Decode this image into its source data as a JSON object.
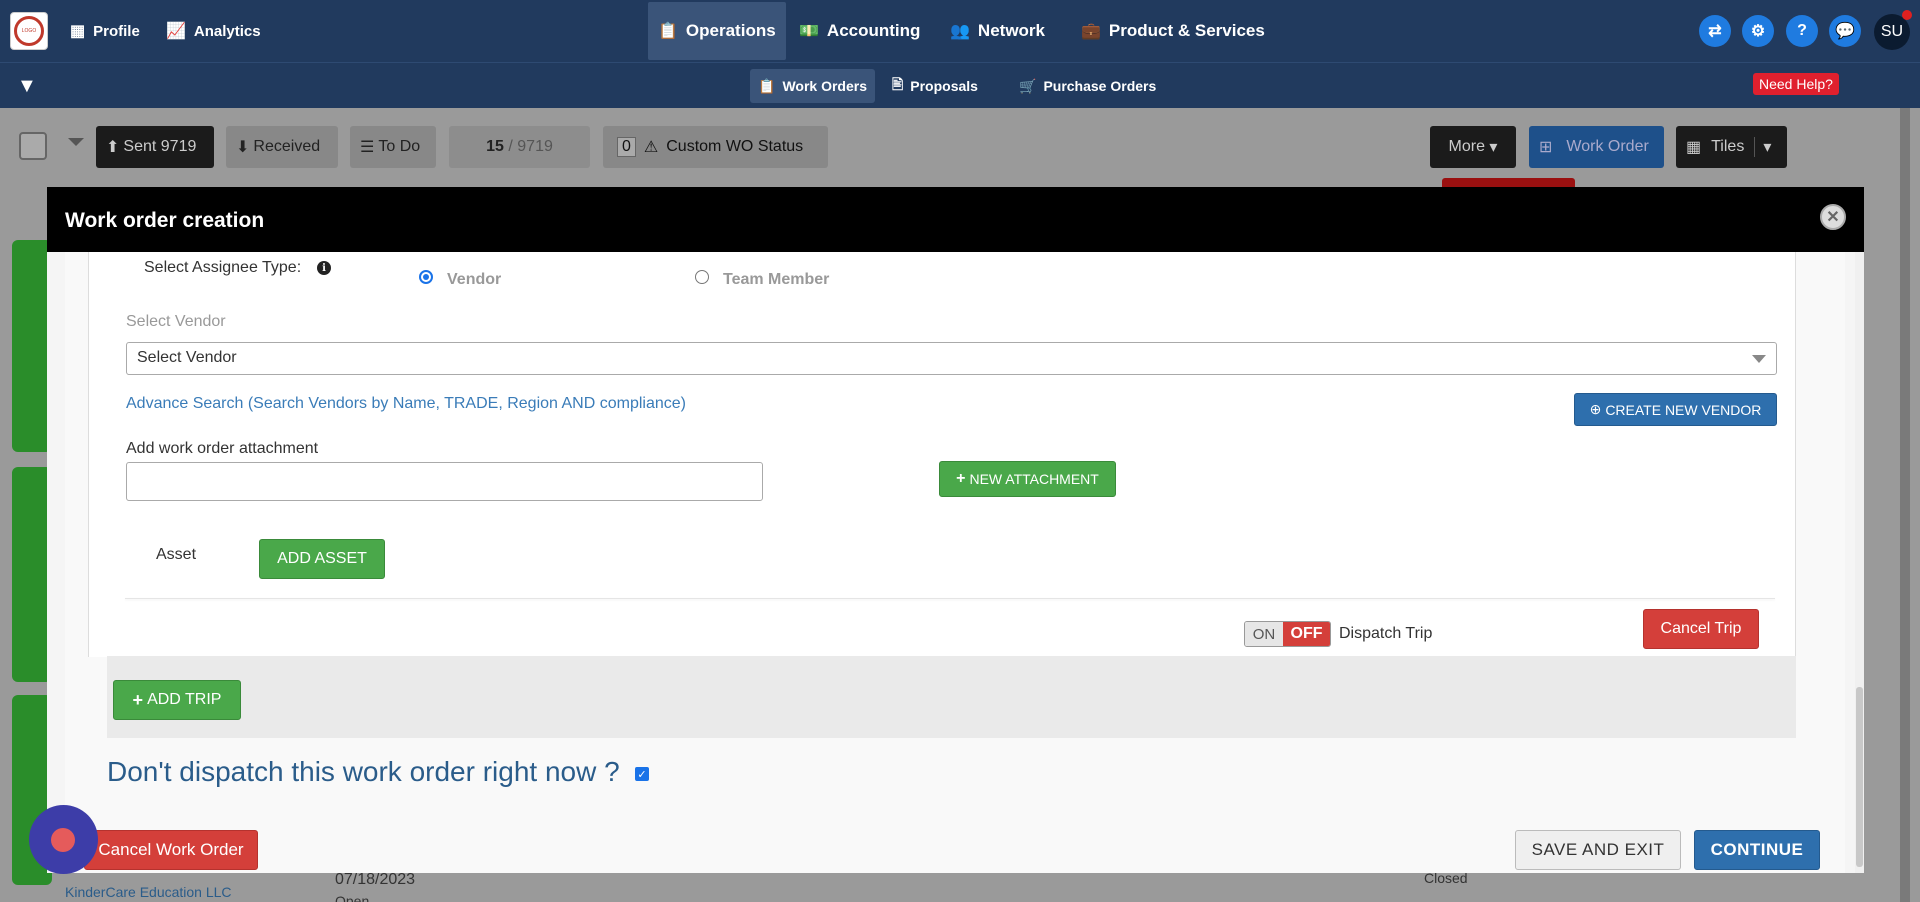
{
  "topnav": {
    "items": [
      {
        "label": "Profile",
        "icon": "building-icon"
      },
      {
        "label": "Analytics",
        "icon": "chart-icon"
      },
      {
        "label": "Operations",
        "icon": "clipboard-icon"
      },
      {
        "label": "Accounting",
        "icon": "money-icon"
      },
      {
        "label": "Network",
        "icon": "people-icon"
      },
      {
        "label": "Product & Services",
        "icon": "briefcase-icon"
      }
    ],
    "avatar": "SU",
    "help_glyph": "?"
  },
  "subnav": {
    "items": [
      {
        "label": "Work Orders",
        "icon": "clipboard-icon"
      },
      {
        "label": "Proposals",
        "icon": "proposal-icon"
      },
      {
        "label": "Purchase Orders",
        "icon": "cart-icon"
      }
    ],
    "need_help": "Need Help?"
  },
  "toolbar": {
    "sent": "Sent 9719",
    "received": "Received",
    "todo": "To Do",
    "page_current": "15",
    "page_total": "/ 9719",
    "custom_count": "0",
    "custom_status": "Custom WO Status",
    "more": "More",
    "work_order": "Work Order",
    "tiles": "Tiles"
  },
  "modal": {
    "title": "Work order creation",
    "assignee_label": "Select Assignee Type:",
    "vendor_option": "Vendor",
    "team_member_option": "Team Member",
    "select_vendor_label": "Select Vendor",
    "select_vendor_value": "Select Vendor",
    "advance_search": "Advance Search (Search Vendors by Name, TRADE, Region AND compliance)",
    "create_vendor": "CREATE NEW VENDOR",
    "attachment_label": "Add work order attachment",
    "new_attachment": "NEW ATTACHMENT",
    "asset_label": "Asset",
    "add_asset": "ADD ASSET",
    "toggle_on": "ON",
    "toggle_off": "OFF",
    "dispatch_trip": "Dispatch Trip",
    "cancel_trip": "Cancel Trip",
    "add_trip": "ADD TRIP",
    "dont_dispatch": "Don't dispatch this work order right now ?",
    "dont_dispatch_checked": true,
    "cancel_work_order": "Cancel Work Order",
    "save_and_exit": "SAVE AND EXIT",
    "continue": "CONTINUE"
  },
  "background": {
    "company": "KinderCare Education LLC",
    "date": "07/18/2023",
    "status_open": "Open",
    "status_closed": "Closed"
  },
  "colors": {
    "nav_bg": "#213a5e",
    "primary_blue": "#2e6fad",
    "success_green": "#4aa84a",
    "danger_red": "#d43f3a"
  }
}
